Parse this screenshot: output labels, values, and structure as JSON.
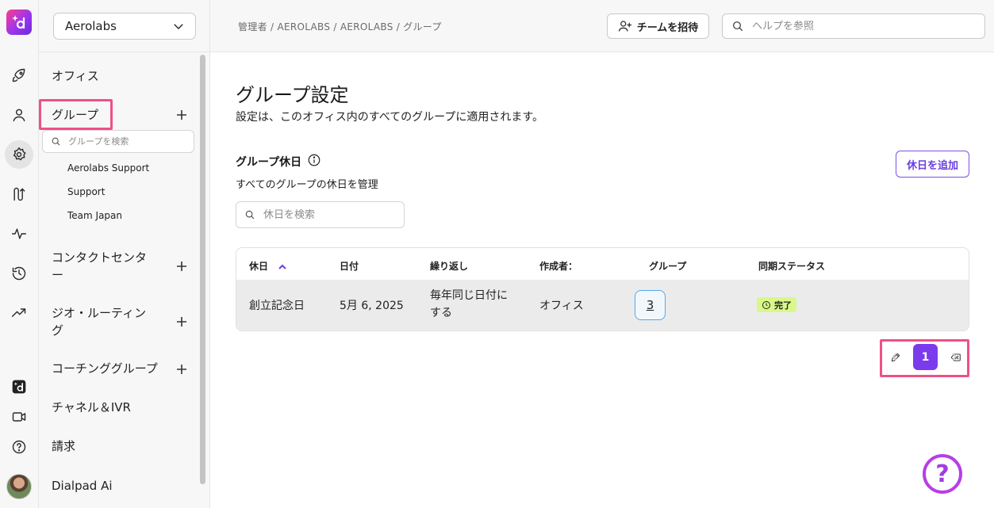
{
  "rail": {
    "items": [
      "rocket-icon",
      "person-icon",
      "gear-icon",
      "route-icon",
      "activity-icon",
      "history-icon",
      "trending-icon",
      "dialpad-app-icon",
      "video-icon",
      "help-circle-icon"
    ]
  },
  "sidebar": {
    "org_select": "Aerolabs",
    "group_search_placeholder": "グループを検索",
    "items": {
      "office": "オフィス",
      "groups": "グループ",
      "contact_center": "コンタクトセンター",
      "geo_routing": "ジオ・ルーティング",
      "coaching_groups": "コーチンググループ",
      "channels_ivr": "チャネル＆IVR",
      "billing": "請求",
      "dialpad_ai": "Dialpad Ai"
    },
    "groups": [
      "Aerolabs Support",
      "Support",
      "Team Japan"
    ]
  },
  "topbar": {
    "breadcrumb": "管理者 / AEROLABS / AEROLABS / グループ",
    "invite_label": "チームを招待",
    "help_placeholder": "ヘルプを参照"
  },
  "main": {
    "title": "グループ設定",
    "subtitle": "設定は、このオフィス内のすべてのグループに適用されます。",
    "section_title": "グループ休日",
    "section_subtitle": "すべてのグループの休日を管理",
    "add_holiday_label": "休日を追加",
    "holiday_search_placeholder": "休日を検索",
    "table": {
      "headers": {
        "holiday": "休日",
        "date": "日付",
        "repeat": "繰り返し",
        "creator": "作成者：",
        "groups": "グループ",
        "sync_status": "同期ステータス"
      },
      "rows": [
        {
          "holiday": "創立記念日",
          "date": "5月 6, 2025",
          "repeat_line1": "毎年同じ日付に",
          "repeat_line2": "する",
          "creator": "オフィス",
          "groups": "3",
          "status": "完了"
        }
      ]
    },
    "pagination": {
      "current_page": "1"
    }
  },
  "colors": {
    "accent": "#7c3aed",
    "highlight": "#ef4f8a",
    "status_done": "#d9f78a"
  }
}
